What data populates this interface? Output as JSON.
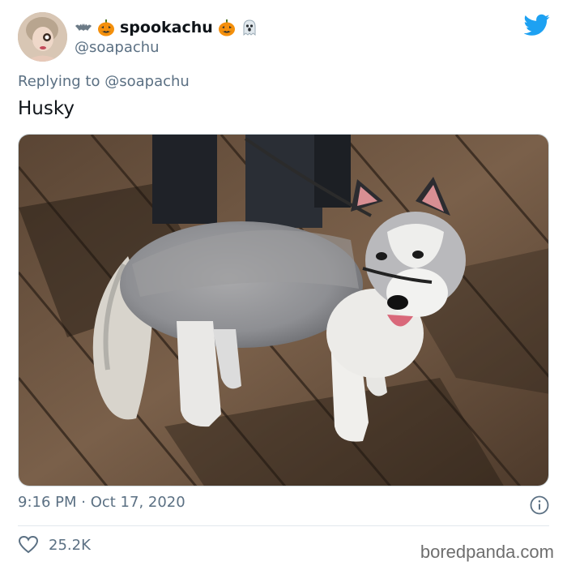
{
  "user": {
    "display_name": "spookachu",
    "handle": "@soapachu",
    "name_emojis_before": [
      "bat-emoji",
      "jack-o-lantern-emoji"
    ],
    "name_emojis_after": [
      "jack-o-lantern-emoji",
      "ghost-emoji"
    ]
  },
  "reply": {
    "prefix": "Replying to",
    "mention": "@soapachu"
  },
  "tweet": {
    "text": "Husky",
    "timestamp": "9:16 PM · Oct 17, 2020"
  },
  "stats": {
    "likes": "25.2K"
  },
  "watermark": "boredpanda.com",
  "colors": {
    "twitter_blue": "#1da1f2",
    "secondary_text": "#5b7083",
    "primary_text": "#0f1419"
  },
  "icons": {
    "brand": "twitter-bird-icon",
    "info": "info-icon",
    "like": "heart-icon"
  }
}
